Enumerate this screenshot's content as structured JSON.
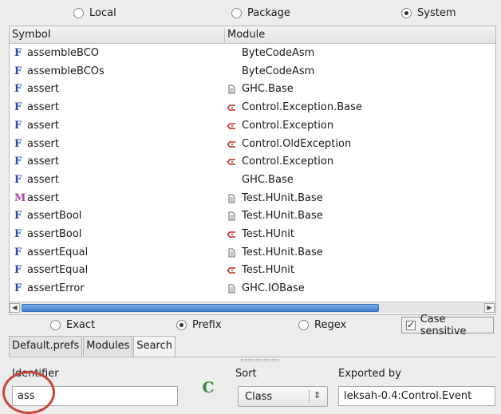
{
  "scope": {
    "options": [
      "Local",
      "Package",
      "System"
    ],
    "selected": "System"
  },
  "columns": {
    "symbol": "Symbol",
    "module": "Module"
  },
  "rows": [
    {
      "kind": "F",
      "symbol": "assembleBCO",
      "module_icon": "none",
      "module": "ByteCodeAsm"
    },
    {
      "kind": "F",
      "symbol": "assembleBCOs",
      "module_icon": "none",
      "module": "ByteCodeAsm"
    },
    {
      "kind": "F",
      "symbol": "assert",
      "module_icon": "file-icon",
      "module": "GHC.Base"
    },
    {
      "kind": "F",
      "symbol": "assert",
      "module_icon": "reexport-icon",
      "module": "Control.Exception.Base"
    },
    {
      "kind": "F",
      "symbol": "assert",
      "module_icon": "reexport-icon",
      "module": "Control.Exception"
    },
    {
      "kind": "F",
      "symbol": "assert",
      "module_icon": "reexport-icon",
      "module": "Control.OldException"
    },
    {
      "kind": "F",
      "symbol": "assert",
      "module_icon": "reexport-icon",
      "module": "Control.Exception"
    },
    {
      "kind": "F",
      "symbol": "assert",
      "module_icon": "none",
      "module": "GHC.Base"
    },
    {
      "kind": "M",
      "symbol": "assert",
      "module_icon": "file-icon",
      "module": "Test.HUnit.Base"
    },
    {
      "kind": "F",
      "symbol": "assertBool",
      "module_icon": "file-icon",
      "module": "Test.HUnit.Base"
    },
    {
      "kind": "F",
      "symbol": "assertBool",
      "module_icon": "reexport-icon",
      "module": "Test.HUnit"
    },
    {
      "kind": "F",
      "symbol": "assertEqual",
      "module_icon": "file-icon",
      "module": "Test.HUnit.Base"
    },
    {
      "kind": "F",
      "symbol": "assertEqual",
      "module_icon": "reexport-icon",
      "module": "Test.HUnit"
    },
    {
      "kind": "F",
      "symbol": "assertError",
      "module_icon": "file-icon",
      "module": "GHC.IOBase"
    }
  ],
  "match_mode": {
    "options": [
      "Exact",
      "Prefix",
      "Regex"
    ],
    "selected": "Prefix",
    "case_sensitive_label": "Case sensitive",
    "case_sensitive": true
  },
  "tabs": [
    "Default.prefs",
    "Modules",
    "Search"
  ],
  "active_tab": "Search",
  "details": {
    "identifier_label": "Identifier",
    "identifier_value": "ass",
    "class_glyph": "C",
    "sort_label": "Sort",
    "sort_value": "Class",
    "exported_label": "Exported by",
    "exported_value": "leksah-0.4:Control.Event"
  },
  "colors": {
    "scroll_thumb": "#3f7fcf",
    "function_icon": "#2a4aa8",
    "method_icon": "#a84aa8",
    "reexport_icon": "#c8463c",
    "class_icon": "#3a8a3a",
    "annotation_circle": "#c8463c"
  }
}
